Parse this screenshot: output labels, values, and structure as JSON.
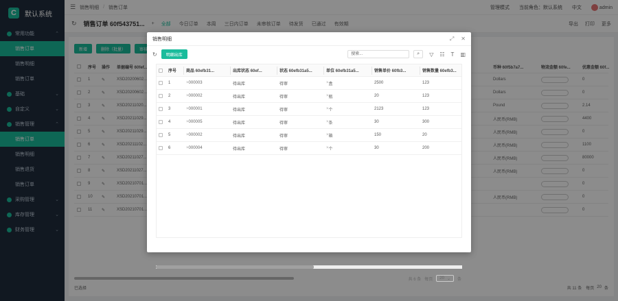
{
  "brand": {
    "title": "默认系统",
    "logo": "C"
  },
  "sidebar": {
    "groups": [
      {
        "label": "常用功能",
        "subs": [
          "销售订单",
          "销售明细",
          "销售订单"
        ]
      },
      {
        "label": "基础",
        "subs": []
      },
      {
        "label": "自定义",
        "subs": []
      },
      {
        "label": "销售管理",
        "subs": [
          "销售订单",
          "销售明细",
          "销售退货",
          "销售订单"
        ]
      },
      {
        "label": "采购管理",
        "subs": []
      },
      {
        "label": "库存管理",
        "subs": []
      },
      {
        "label": "财务管理",
        "subs": []
      }
    ]
  },
  "topbar": {
    "crumbs": [
      "销售明细",
      "销售订单"
    ],
    "items": [
      "管理模式",
      "当前角色：默认系统",
      "中文",
      "admin"
    ]
  },
  "titlebar": {
    "title": "销售订单 60f543751...",
    "tabs": [
      "全部",
      "今日订单",
      "本周",
      "三日内订单",
      "未审核订单",
      "待发货",
      "已通过",
      "有效期"
    ],
    "actions": [
      "导出",
      "打印",
      "更多"
    ]
  },
  "main": {
    "buttons": [
      "新增",
      "删除（批量）",
      "审核"
    ],
    "headers": [
      "序号",
      "操作",
      "单据编号 60fef..."
    ],
    "rows": [
      {
        "no": "1",
        "code": "XSD20200602..."
      },
      {
        "no": "2",
        "code": "XSD20200602..."
      },
      {
        "no": "3",
        "code": "XSD20211020..."
      },
      {
        "no": "4",
        "code": "XSD20211029..."
      },
      {
        "no": "5",
        "code": "XSD20211029..."
      },
      {
        "no": "6",
        "code": "XSD20211102..."
      },
      {
        "no": "7",
        "code": "XSD20211027..."
      },
      {
        "no": "8",
        "code": "XSD20211027..."
      },
      {
        "no": "9",
        "code": "XSD20210701..."
      },
      {
        "no": "10",
        "code": "XSD20210701..."
      },
      {
        "no": "11",
        "code": "XSD20210701..."
      }
    ],
    "right_headers": [
      "币种 60f5b7a7...",
      "物流金额 60fe...",
      "优惠金额 60f..."
    ],
    "right_rows": [
      [
        "Dollars",
        "",
        "0"
      ],
      [
        "Dollars",
        "",
        "0"
      ],
      [
        "Pound",
        "",
        "2.14"
      ],
      [
        "人民币(RMB)",
        "",
        "4400"
      ],
      [
        "人民币(RMB)",
        "",
        "0"
      ],
      [
        "人民币(RMB)",
        "",
        "1100"
      ],
      [
        "人民币(RMB)",
        "",
        "80000"
      ],
      [
        "人民币(RMB)",
        "",
        "0"
      ],
      [
        "",
        "",
        "0"
      ],
      [
        "人民币(RMB)",
        "",
        "0"
      ],
      [
        "",
        "",
        "0"
      ]
    ],
    "footer_left": "已选择",
    "footer_right": [
      "共 11 条",
      "每页",
      "20",
      "条"
    ]
  },
  "dialog": {
    "title": "销售明细",
    "print_button": "明细出库",
    "search_placeholder": "搜索...",
    "headers": [
      "序号",
      "商品 60efb31...",
      "出库状态 60ef...",
      "状态 60efb31a5...",
      "单位 60efb31a5...",
      "销售单价 60fb3...",
      "销售数量 60efb3..."
    ],
    "rows": [
      {
        "no": "1",
        "product": "000003",
        "out_status": "待出库",
        "status": "待审",
        "unit": "盒",
        "price": "2500",
        "qty": "123"
      },
      {
        "no": "2",
        "product": "000002",
        "out_status": "待出库",
        "status": "待审",
        "unit": "瓶",
        "price": "20",
        "qty": "123"
      },
      {
        "no": "3",
        "product": "000001",
        "out_status": "待出库",
        "status": "待审",
        "unit": "个",
        "price": "2123",
        "qty": "123"
      },
      {
        "no": "4",
        "product": "000005",
        "out_status": "待出库",
        "status": "待审",
        "unit": "条",
        "price": "30",
        "qty": "300"
      },
      {
        "no": "5",
        "product": "000002",
        "out_status": "待出库",
        "status": "待审",
        "unit": "箱",
        "price": "150",
        "qty": "20"
      },
      {
        "no": "6",
        "product": "000004",
        "out_status": "待出库",
        "status": "待审",
        "unit": "个",
        "price": "30",
        "qty": "200"
      }
    ],
    "footer": {
      "total": "共 6 条",
      "per_page_label": "每页",
      "page_size": "20",
      "unit": "条"
    }
  }
}
